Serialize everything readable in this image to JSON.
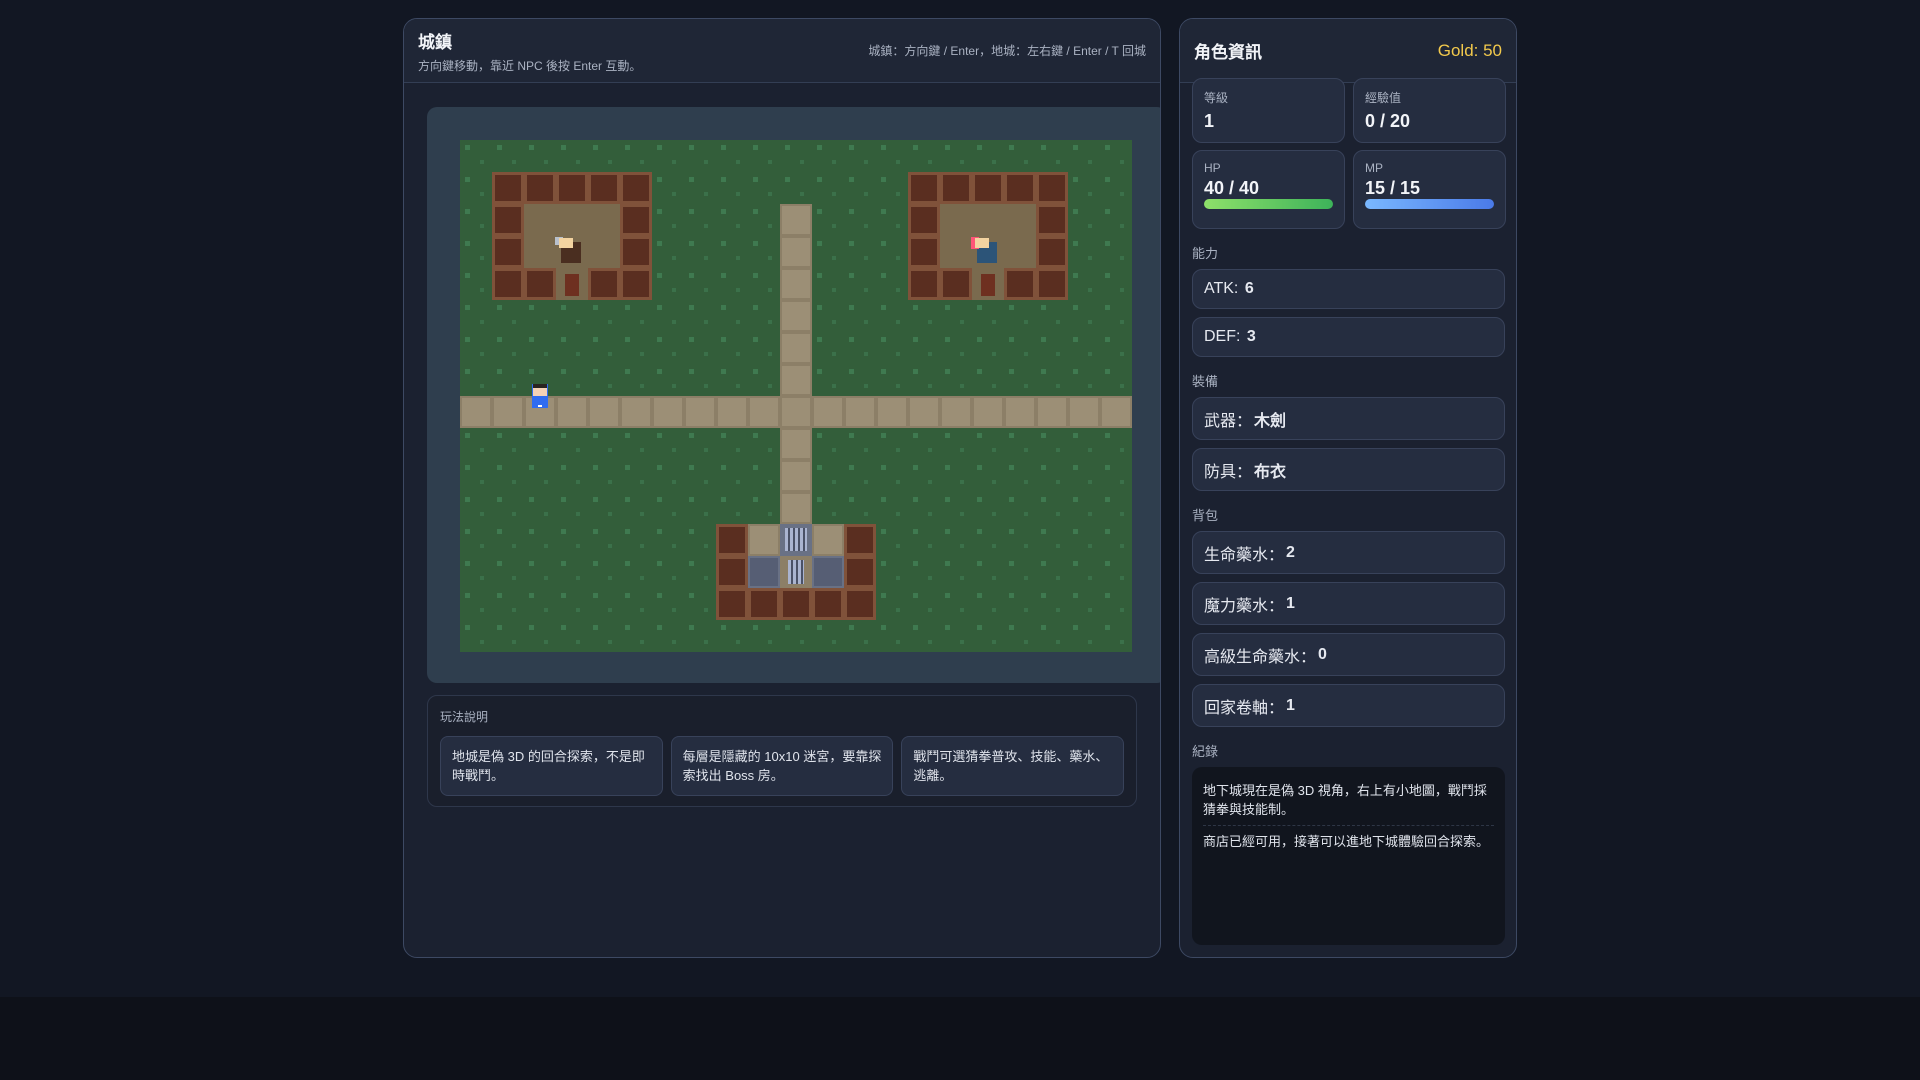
{
  "town": {
    "title": "城鎮",
    "subtitle": "方向鍵移動，靠近 NPC 後按 Enter 互動。",
    "controls_hint": "城鎮：方向鍵 / Enter，地城：左右鍵 / Enter / T 回城",
    "map_legend": {
      "G": "grass",
      "W": "wall",
      "F": "floor",
      "D": "door",
      "R": "road",
      "S": "stairs",
      "P": "stairs-on-path",
      "X": "stone-floor"
    },
    "map": [
      "GGGGGGGGGGGGGGGGGGGGG",
      "GWWWWWGGGGGGGGWWWWWGG",
      "GWFFFWGGGGRGGGWFFFWGG",
      "GWFFFWGGGGRGGGWFFFWGG",
      "GWWDWWGGGGRGGGWWDWWGG",
      "GGGGGGGGGGRGGGGGGGGGG",
      "GGGGGGGGGGRGGGGGGGGGG",
      "GGGGGGGGGGRGGGGGGGGGG",
      "RRRRRRRRRRRRRRRRRRRRR",
      "GGGGGGGGGGRGGGGGGGGGG",
      "GGGGGGGGGGRGGGGGGGGGG",
      "GGGGGGGGGGRGGGGGGGGGG",
      "GGGGGGGGWRSRWGGGGGGGG",
      "GGGGGGGGWXPXWGGGGGGGG",
      "GGGGGGGGWWWWWGGGGGGGG",
      "GGGGGGGGGGGGGGGGGGGGG"
    ],
    "player": {
      "col": 2,
      "row": 7
    },
    "npcs": [
      {
        "name": "weapon-smith-npc",
        "col": 3,
        "row": 3,
        "accent": "#b8c0cc",
        "body": "#4a2e20"
      },
      {
        "name": "item-shop-npc",
        "col": 16,
        "row": 3,
        "accent": "#ff5577",
        "body": "#2c5478"
      }
    ],
    "instructions": {
      "label": "玩法說明",
      "items": [
        "地城是偽 3D 的回合探索，不是即時戰鬥。",
        "每層是隱藏的 10x10 迷宮，要靠探索找出 Boss 房。",
        "戰鬥可選猜拳普攻、技能、藥水、逃離。"
      ]
    }
  },
  "character": {
    "title": "角色資訊",
    "gold": "Gold: 50",
    "level_label": "等級",
    "level": "1",
    "exp_label": "經驗值",
    "exp": "0 / 20",
    "hp_label": "HP",
    "hp": "40 / 40",
    "hp_fraction": 1.0,
    "mp_label": "MP",
    "mp": "15 / 15",
    "mp_fraction": 1.0,
    "abilities_label": "能力",
    "atk_label": "ATK:",
    "atk": "6",
    "def_label": "DEF:",
    "def": "3",
    "equipment_label": "裝備",
    "weapon_label": "武器：",
    "weapon": "木劍",
    "armor_label": "防具：",
    "armor": "布衣",
    "bag_label": "背包",
    "bag": [
      {
        "label": "生命藥水：",
        "count": "2"
      },
      {
        "label": "魔力藥水：",
        "count": "1"
      },
      {
        "label": "高級生命藥水：",
        "count": "0"
      },
      {
        "label": "回家卷軸：",
        "count": "1"
      }
    ],
    "log_label": "紀錄",
    "log": [
      "地下城現在是偽 3D 視角，右上有小地圖，戰鬥採猜拳與技能制。",
      "商店已經可用，接著可以進地下城體驗回合探索。"
    ]
  },
  "colors": {
    "gold": "#f2c94c",
    "hp_bar": [
      "#8ee06a",
      "#3db35a"
    ],
    "mp_bar": [
      "#7ab8ff",
      "#4a7ae8"
    ]
  }
}
